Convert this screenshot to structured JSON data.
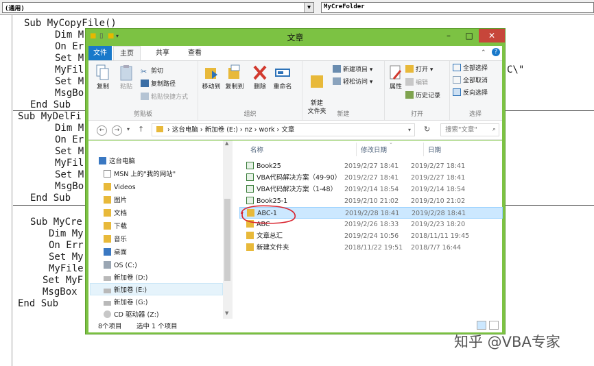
{
  "vba": {
    "object_combo": "(通用)",
    "proc_combo": "MyCreFolder",
    "lines": [
      "Sub MyCopyFile()",
      "Dim M",
      "On Er",
      "Set M",
      "MyFil",
      "Set M",
      "MsgBo",
      "End Sub",
      "Sub MyDelFi",
      "Dim M",
      "On Er",
      "Set M",
      "MyFil",
      "Set M",
      "MsgBo",
      "End Sub",
      "Sub MyCre",
      "Dim My",
      "On Err",
      "Set My",
      "MyFile",
      "Set MyF",
      "MsgBox",
      "End Sub",
      "C\\\""
    ]
  },
  "explorer": {
    "title": "文章",
    "tabs": [
      "文件",
      "主页",
      "共享",
      "查看"
    ],
    "groups": {
      "clipboard": {
        "label": "剪贴板",
        "copy": "复制",
        "paste": "粘贴",
        "cut": "剪切",
        "copy_path": "复制路径",
        "paste_shortcut": "粘贴快捷方式"
      },
      "organize": {
        "label": "组织",
        "move_to": "移动到",
        "copy_to": "复制到",
        "delete": "删除",
        "rename": "重命名"
      },
      "new": {
        "label": "新建",
        "new_folder": "新建\n文件夹",
        "new_item": "新建项目 ▾",
        "easy_access": "轻松访问 ▾"
      },
      "open": {
        "label": "打开",
        "properties": "属性",
        "open": "打开 ▾",
        "edit": "编辑",
        "history": "历史记录"
      },
      "select": {
        "label": "选择",
        "select_all": "全部选择",
        "select_none": "全部取消",
        "invert": "反向选择"
      }
    },
    "address": {
      "path": "›  这台电脑  ›  新加卷 (E:)  ›  nz  ›  work  ›  文章",
      "search_placeholder": "搜索\"文章\""
    },
    "nav_items": [
      {
        "label": "这台电脑",
        "icon": "pc-icon"
      },
      {
        "label": "MSN 上的\"我的网站\"",
        "icon": "page-icon"
      },
      {
        "label": "Videos",
        "icon": "folder-icon"
      },
      {
        "label": "图片",
        "icon": "folder-icon"
      },
      {
        "label": "文档",
        "icon": "folder-icon"
      },
      {
        "label": "下载",
        "icon": "folder-icon"
      },
      {
        "label": "音乐",
        "icon": "folder-icon"
      },
      {
        "label": "桌面",
        "icon": "folder-icon"
      },
      {
        "label": "OS (C:)",
        "icon": "drive-icon"
      },
      {
        "label": "新加卷 (D:)",
        "icon": "drive-icon"
      },
      {
        "label": "新加卷 (E:)",
        "icon": "drive-icon"
      },
      {
        "label": "新加卷 (G:)",
        "icon": "drive-icon"
      },
      {
        "label": "CD 驱动器 (Z:)",
        "icon": "cd-icon"
      }
    ],
    "columns": {
      "name": "名称",
      "modified": "修改日期",
      "date": "日期"
    },
    "files": [
      {
        "name": "Book25",
        "modified": "2019/2/27 18:41",
        "date": "2019/2/27 18:41",
        "icon": "excel-icon"
      },
      {
        "name": "VBA代码解决方案（49-90）",
        "modified": "2019/2/27 18:41",
        "date": "2019/2/27 18:41",
        "icon": "excel-icon"
      },
      {
        "name": "VBA代码解决方案（1-48）",
        "modified": "2019/2/14 18:54",
        "date": "2019/2/14 18:54",
        "icon": "excel-icon"
      },
      {
        "name": "Book25-1",
        "modified": "2019/2/10 21:02",
        "date": "2019/2/10 21:02",
        "icon": "excel-icon"
      },
      {
        "name": "ABC-1",
        "modified": "2019/2/28 18:41",
        "date": "2019/2/28 18:41",
        "icon": "folder-icon"
      },
      {
        "name": "ABC",
        "modified": "2019/2/26 18:33",
        "date": "2019/2/23 18:20",
        "icon": "folder-icon"
      },
      {
        "name": "文章总汇",
        "modified": "2019/2/24 10:56",
        "date": "2018/11/11 19:45",
        "icon": "folder-icon"
      },
      {
        "name": "新建文件夹",
        "modified": "2018/11/22 19:51",
        "date": "2018/7/7 16:44",
        "icon": "folder-icon"
      }
    ],
    "status": {
      "count": "8个项目",
      "selected": "选中 1 个项目"
    }
  },
  "watermark": "知乎 @VBA专家",
  "colors": {
    "window_frame": "#7cc243",
    "file_tab": "#1979ca",
    "close_button": "#c7463a",
    "selection": "#cce8ff",
    "annotation": "#d9232e"
  }
}
